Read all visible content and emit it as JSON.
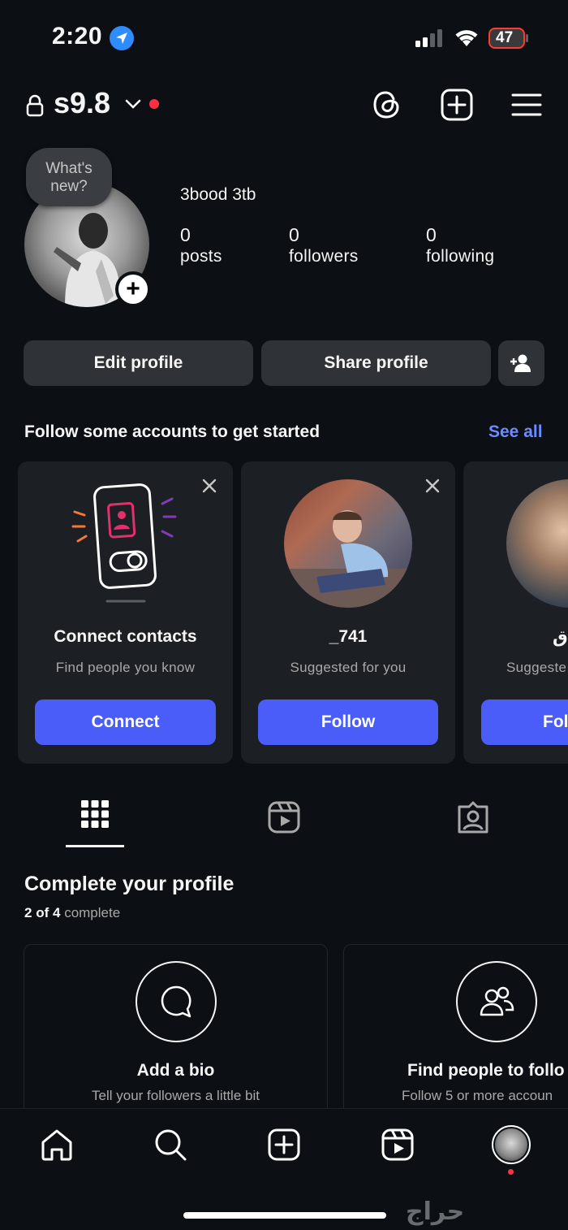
{
  "status_bar": {
    "time": "2:20",
    "battery": "47"
  },
  "header": {
    "username": "s9.8"
  },
  "profile": {
    "bubble_text": "What's new?",
    "full_name": "3bood 3tb",
    "stats": [
      {
        "value": "0",
        "label": "posts"
      },
      {
        "value": "0",
        "label": "followers"
      },
      {
        "value": "0",
        "label": "following"
      }
    ]
  },
  "actions": {
    "edit_profile": "Edit profile",
    "share_profile": "Share profile"
  },
  "suggestions": {
    "title": "Follow some accounts to get started",
    "see_all": "See all",
    "cards": [
      {
        "title": "Connect contacts",
        "subtitle": "Find people you know",
        "button": "Connect"
      },
      {
        "title": "_741",
        "subtitle": "Suggested for you",
        "button": "Follow"
      },
      {
        "title": "ق",
        "subtitle": "Suggeste",
        "button": "Fol"
      }
    ]
  },
  "complete_profile": {
    "title": "Complete your profile",
    "progress_done": "2",
    "progress_total": "4",
    "progress_word": "of",
    "progress_suffix": "complete",
    "cards": [
      {
        "title": "Add a bio",
        "subtitle": "Tell your followers a little bit"
      },
      {
        "title": "Find people to follo",
        "subtitle": "Follow 5 or more accoun"
      }
    ]
  },
  "watermark": "حراج"
}
